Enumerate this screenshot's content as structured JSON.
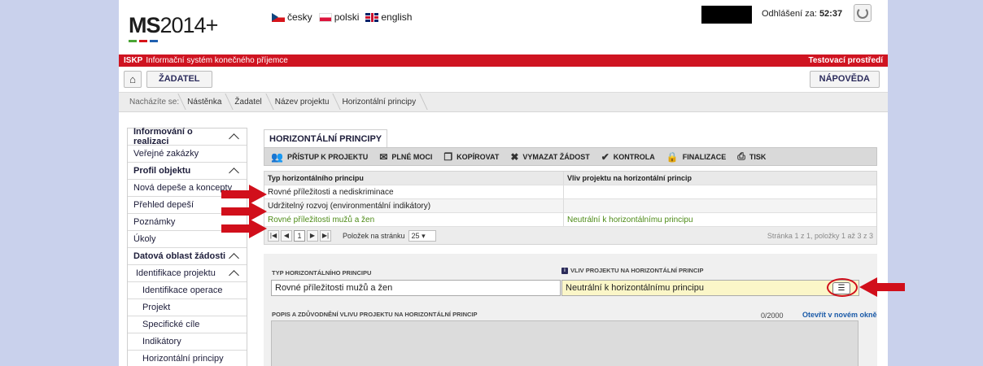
{
  "app": {
    "logo_text": "MS",
    "logo_year": "2014+",
    "logo_colors": [
      "#4aa534",
      "#d7141a",
      "#2060b0"
    ],
    "languages": [
      "česky",
      "polski",
      "english"
    ],
    "logout_label": "Odhlášení za:",
    "logout_time": "52:37",
    "system_label": "ISKP",
    "system_name": "Informační systém konečného příjemce",
    "environment": "Testovací prostředí",
    "accent_color": "#cf1421"
  },
  "nav": {
    "home_icon": "home-icon",
    "role_button": "ŽADATEL",
    "help_button": "NÁPOVĚDA"
  },
  "breadcrumb": {
    "label": "Nacházíte se:",
    "items": [
      "Nástěnka",
      "Žadatel",
      "Název projektu",
      "Horizontální principy"
    ]
  },
  "sidebar": {
    "items": [
      {
        "label": "Informování o realizaci",
        "type": "head"
      },
      {
        "label": "Veřejné zakázky",
        "type": "item"
      },
      {
        "label": "Profil objektu",
        "type": "head"
      },
      {
        "label": "Nová depeše a koncepty",
        "type": "item"
      },
      {
        "label": "Přehled depeší",
        "type": "item"
      },
      {
        "label": "Poznámky",
        "type": "item"
      },
      {
        "label": "Úkoly",
        "type": "item"
      },
      {
        "label": "Datová oblast žádosti",
        "type": "head"
      },
      {
        "label": "Identifikace projektu",
        "type": "sub"
      },
      {
        "label": "Identifikace operace",
        "type": "sub2"
      },
      {
        "label": "Projekt",
        "type": "sub2"
      },
      {
        "label": "Specifické cíle",
        "type": "sub2"
      },
      {
        "label": "Indikátory",
        "type": "sub2"
      },
      {
        "label": "Horizontální principy",
        "type": "sub2"
      }
    ]
  },
  "main": {
    "tab": "HORIZONTÁLNÍ PRINCIPY",
    "toolbar": [
      {
        "label": "PŘÍSTUP K PROJEKTU",
        "icon": "people-icon"
      },
      {
        "label": "PLNÉ MOCI",
        "icon": "mail-icon"
      },
      {
        "label": "KOPÍROVAT",
        "icon": "copy-icon"
      },
      {
        "label": "VYMAZAT ŽÁDOST",
        "icon": "delete-icon"
      },
      {
        "label": "KONTROLA",
        "icon": "check-icon"
      },
      {
        "label": "FINALIZACE",
        "icon": "lock-icon"
      },
      {
        "label": "TISK",
        "icon": "print-icon"
      }
    ],
    "table": {
      "headers": [
        "Typ horizontálního principu",
        "Vliv projektu na horizontální princip"
      ],
      "rows": [
        [
          "Rovné příležitosti a nediskriminace",
          ""
        ],
        [
          "Udržitelný rozvoj (environmentální indikátory)",
          ""
        ],
        [
          "Rovné příležitosti mužů a žen",
          "Neutrální k horizontálnímu principu"
        ]
      ],
      "current_page": "1",
      "page_size_label": "Položek na stránku",
      "page_size": "25",
      "summary": "Stránka 1 z 1, položky 1 až 3 z 3"
    },
    "form": {
      "type_label": "TYP HORIZONTÁLNÍHO PRINCIPU",
      "type_value": "Rovné příležitosti mužů a žen",
      "impact_label": "VLIV PROJEKTU NA HORIZONTÁLNÍ PRINCIP",
      "impact_value": "Neutrální k horizontálnímu principu",
      "description_label": "POPIS A ZDŮVODNĚNÍ VLIVU PROJEKTU NA HORIZONTÁLNÍ PRINCIP",
      "counter": "0/2000",
      "open_link": "Otevřít v novém okně"
    }
  },
  "annotation_color": "#d10f1b"
}
